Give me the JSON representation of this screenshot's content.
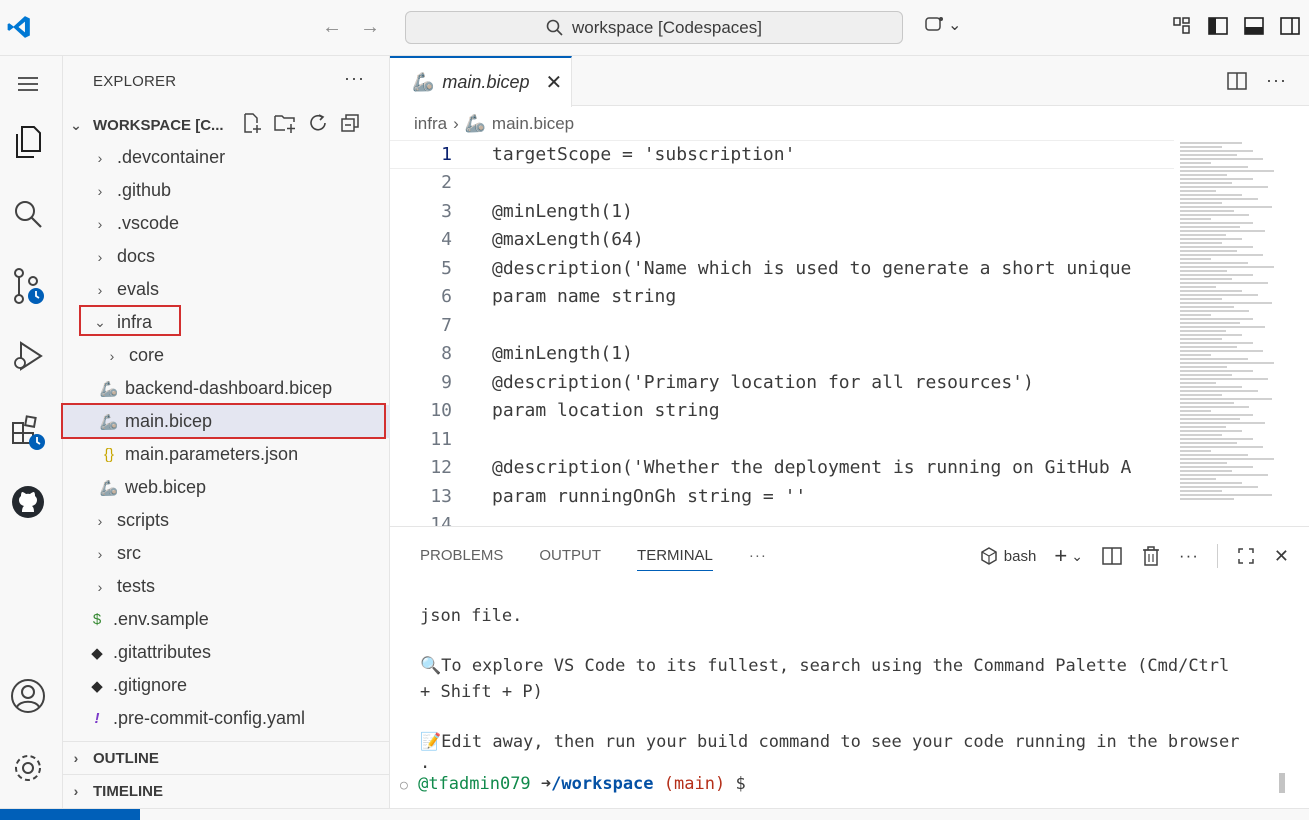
{
  "titlebar": {
    "search_text": "workspace [Codespaces]"
  },
  "activity": [
    "explorer-icon",
    "search-icon",
    "source-control-icon",
    "run-debug-icon",
    "extensions-icon",
    "github-icon",
    "account-icon",
    "settings-gear-icon"
  ],
  "sidebar": {
    "title": "EXPLORER",
    "more": "···",
    "workspace_label": "WORKSPACE [C...",
    "tree": [
      {
        "label": ".devcontainer",
        "type": "folder"
      },
      {
        "label": ".github",
        "type": "folder"
      },
      {
        "label": ".vscode",
        "type": "folder"
      },
      {
        "label": "docs",
        "type": "folder"
      },
      {
        "label": "evals",
        "type": "folder"
      },
      {
        "label": "infra",
        "type": "folder-open"
      },
      {
        "label": "core",
        "type": "folder"
      },
      {
        "label": "backend-dashboard.bicep",
        "type": "bicep"
      },
      {
        "label": "main.bicep",
        "type": "bicep"
      },
      {
        "label": "main.parameters.json",
        "type": "json"
      },
      {
        "label": "web.bicep",
        "type": "bicep"
      },
      {
        "label": "scripts",
        "type": "folder"
      },
      {
        "label": "src",
        "type": "folder"
      },
      {
        "label": "tests",
        "type": "folder"
      },
      {
        "label": ".env.sample",
        "type": "env"
      },
      {
        "label": ".gitattributes",
        "type": "git"
      },
      {
        "label": ".gitignore",
        "type": "git"
      },
      {
        "label": ".pre-commit-config.yaml",
        "type": "yaml"
      }
    ],
    "outline": "OUTLINE",
    "timeline": "TIMELINE"
  },
  "editor": {
    "tab_label": "main.bicep",
    "breadcrumb_folder": "infra",
    "breadcrumb_file": "main.bicep",
    "lines": [
      {
        "n": "1",
        "text": "targetScope = 'subscription'"
      },
      {
        "n": "2",
        "text": ""
      },
      {
        "n": "3",
        "text": "@minLength(1)"
      },
      {
        "n": "4",
        "text": "@maxLength(64)"
      },
      {
        "n": "5",
        "text": "@description('Name which is used to generate a short unique"
      },
      {
        "n": "6",
        "text": "param name string"
      },
      {
        "n": "7",
        "text": ""
      },
      {
        "n": "8",
        "text": "@minLength(1)"
      },
      {
        "n": "9",
        "text": "@description('Primary location for all resources')"
      },
      {
        "n": "10",
        "text": "param location string"
      },
      {
        "n": "11",
        "text": ""
      },
      {
        "n": "12",
        "text": "@description('Whether the deployment is running on GitHub A"
      },
      {
        "n": "13",
        "text": "param runningOnGh string = ''"
      },
      {
        "n": "14",
        "text": ""
      }
    ]
  },
  "panel": {
    "tabs": [
      "PROBLEMS",
      "OUTPUT",
      "TERMINAL"
    ],
    "more": "···",
    "shell": "bash",
    "term_line1": "json file.",
    "term_line2": "To explore VS Code to its fullest, search using the Command Palette (Cmd/Ctrl",
    "term_line3": "+ Shift + P)",
    "term_line4": "Edit away, then run your build command to see your code running in the browser",
    "term_line5": ".",
    "prompt_user": "@tfadmin079",
    "prompt_arrow": "➜",
    "prompt_path": "/workspace",
    "prompt_branch": "(main)",
    "prompt_symbol": "$"
  },
  "colors": {
    "accent": "#005fb8",
    "highlight_box": "#d32f2f",
    "bicep_icon": "#3b6ea5",
    "json_icon": "#c7a600",
    "env_icon": "#388a34"
  }
}
